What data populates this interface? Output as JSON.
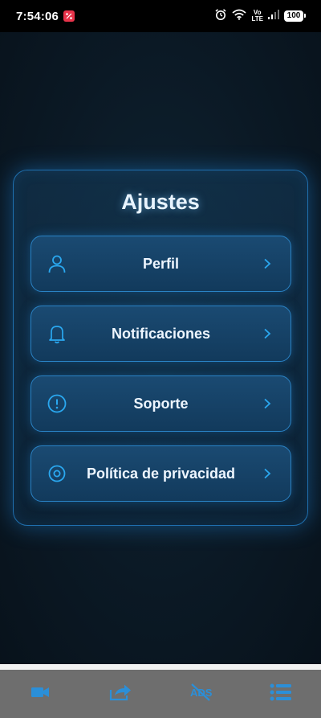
{
  "status_bar": {
    "time": "7:54:06",
    "volte_top": "Vo",
    "volte_bottom": "LTE",
    "battery": "100"
  },
  "settings": {
    "title": "Ajustes",
    "items": [
      {
        "label": "Perfil",
        "icon": "user-icon"
      },
      {
        "label": "Notificaciones",
        "icon": "bell-icon"
      },
      {
        "label": "Soporte",
        "icon": "alert-circle-icon"
      },
      {
        "label": "Política de privacidad",
        "icon": "eye-icon"
      }
    ]
  },
  "bottom_bar": {
    "items": [
      {
        "icon": "video-camera-icon"
      },
      {
        "icon": "share-icon"
      },
      {
        "icon": "ads-off-icon"
      },
      {
        "icon": "list-icon"
      }
    ]
  },
  "colors": {
    "accent": "#2aa8f0",
    "card_border": "#1f6fae",
    "bottom_bar": "#6e6e6e",
    "bottom_icon": "#2b8fd8"
  }
}
